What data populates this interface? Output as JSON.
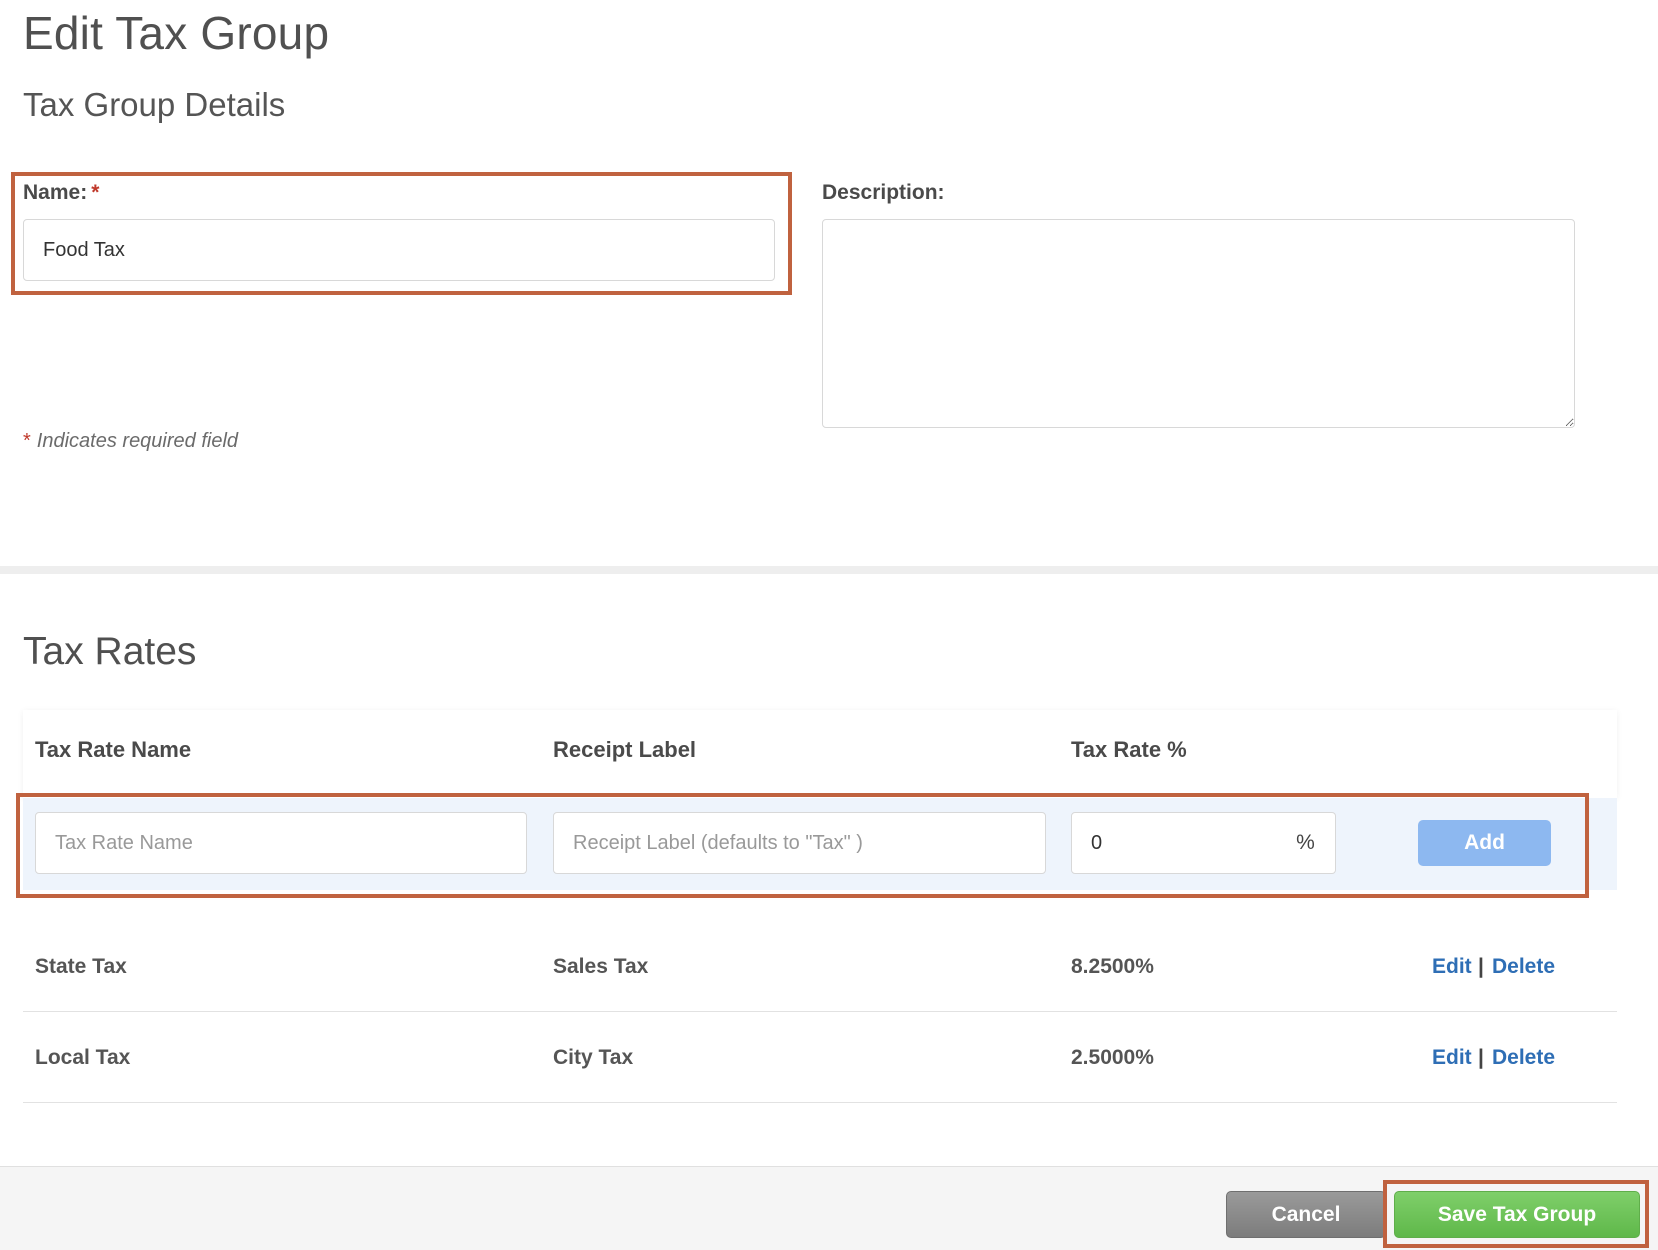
{
  "page": {
    "title": "Edit Tax Group",
    "section_title": "Tax Group Details"
  },
  "form": {
    "name_label": "Name:",
    "required_star": "*",
    "name_value": "Food Tax",
    "description_label": "Description:",
    "description_value": "",
    "required_note_star": "*",
    "required_note": "Indicates required field"
  },
  "tax_rates": {
    "title": "Tax Rates",
    "columns": [
      "Tax Rate Name",
      "Receipt Label",
      "Tax Rate %"
    ],
    "new_row": {
      "name_placeholder": "Tax Rate Name",
      "label_placeholder": "Receipt Label (defaults to \"Tax\" )",
      "rate_value": "0",
      "percent_symbol": "%",
      "add_label": "Add"
    },
    "rows": [
      {
        "name": "State Tax",
        "label": "Sales Tax",
        "rate": "8.2500%",
        "edit": "Edit",
        "separator": "|",
        "delete": "Delete"
      },
      {
        "name": "Local Tax",
        "label": "City Tax",
        "rate": "2.5000%",
        "edit": "Edit",
        "separator": "|",
        "delete": "Delete"
      }
    ]
  },
  "footer": {
    "cancel_label": "Cancel",
    "save_label": "Save Tax Group"
  },
  "colors": {
    "highlight": "#c0623f",
    "link": "#2e6eb5",
    "add_button": "#8db8f0",
    "save_button": "#5fb84a",
    "cancel_button": "#7c7c7c",
    "required": "#c0392b"
  }
}
